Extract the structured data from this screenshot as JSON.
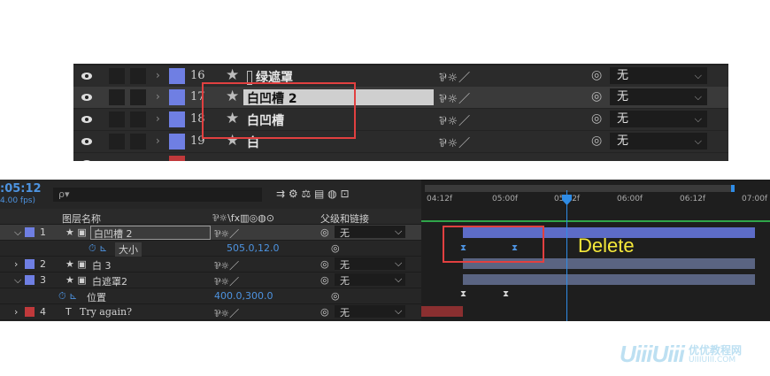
{
  "top_panel": {
    "rows": [
      {
        "num": "16",
        "name": "绿遮罩",
        "parent": "无",
        "color": "#6f7fe3"
      },
      {
        "num": "17",
        "name": "白凹槽 2",
        "parent": "无",
        "color": "#6f7fe3"
      },
      {
        "num": "18",
        "name": "白凹槽",
        "parent": "无",
        "color": "#6f7fe3"
      },
      {
        "num": "19",
        "name": "白",
        "parent": "无",
        "color": "#6f7fe3"
      }
    ]
  },
  "timeline": {
    "timecode": ":05:12",
    "fps": "4.00 fps)",
    "search_placeholder": "ρ▾",
    "col_layer_name": "图层名称",
    "col_parent": "父级和链接",
    "ruler": [
      "04:12f",
      "05:00f",
      "05:12f",
      "06:00f",
      "06:12f",
      "07:00f"
    ],
    "layers": [
      {
        "num": "1",
        "name": "白凹槽 2",
        "parent": "无",
        "color": "#6f7fe3"
      },
      {
        "prop": "大小",
        "value": "505.0,12.0"
      },
      {
        "num": "2",
        "name": "白 3",
        "parent": "无",
        "color": "#6f7fe3"
      },
      {
        "num": "3",
        "name": "白遮罩2",
        "parent": "无",
        "color": "#6f7fe3"
      },
      {
        "prop": "位置",
        "value": "400.0,300.0"
      },
      {
        "num": "4",
        "name": "Try again?",
        "parent": "无",
        "color": "#c0393b"
      }
    ]
  },
  "annotation": "Delete",
  "watermark": {
    "brand": "UiiiUiii",
    "cn": "优优教程网",
    "url": "UIIIUIII.COM"
  },
  "colors": {
    "label_blue": "#6f7fe3",
    "label_red": "#c0393b",
    "playhead": "#2f8ce6",
    "annotation": "#f6e93a"
  }
}
